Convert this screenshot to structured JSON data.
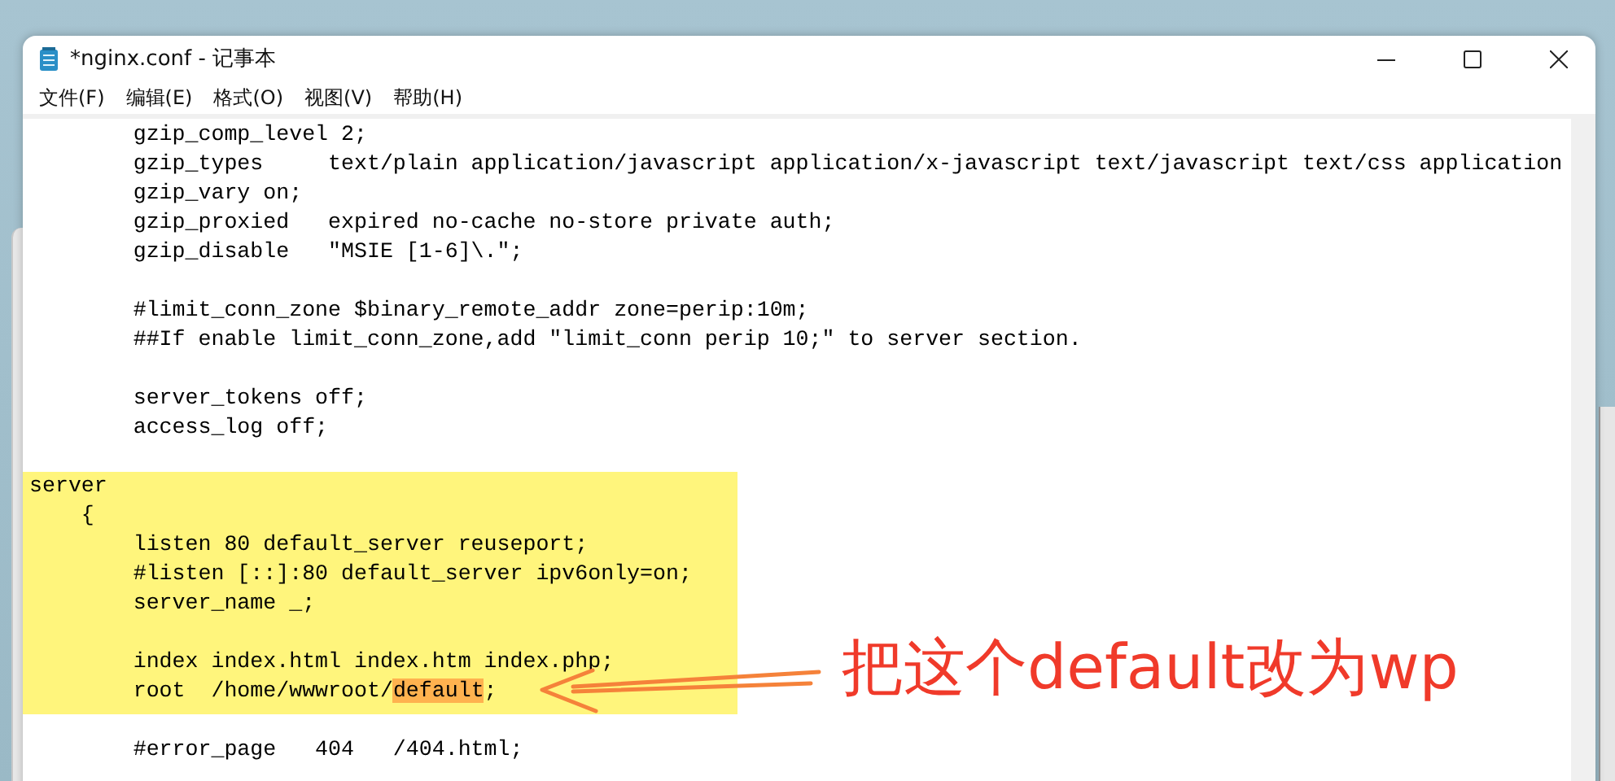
{
  "window": {
    "title": "*nginx.conf - 记事本"
  },
  "menu": [
    "文件(F)",
    "编辑(E)",
    "格式(O)",
    "视图(V)",
    "帮助(H)"
  ],
  "editor": {
    "sections": [
      {
        "highlighted": false,
        "paragraphs": [
          [
            {
              "text": "        gzip_comp_level 2;"
            },
            {
              "text": "        gzip_types     text/plain application/javascript application/x-javascript text/javascript text/css application"
            },
            {
              "text": "        gzip_vary on;"
            },
            {
              "text": "        gzip_proxied   expired no-cache no-store private auth;"
            },
            {
              "text": "        gzip_disable   \"MSIE [1-6]\\.\";"
            }
          ],
          [
            {
              "text": "        #limit_conn_zone $binary_remote_addr zone=perip:10m;"
            },
            {
              "text": "        ##If enable limit_conn_zone,add \"limit_conn perip 10;\" to server section."
            }
          ],
          [
            {
              "text": "        server_tokens off;"
            },
            {
              "text": "        access_log off;"
            }
          ]
        ]
      },
      {
        "highlighted": true,
        "paragraphs": [
          [
            {
              "text": "server"
            },
            {
              "text": "    {"
            },
            {
              "text": "        listen 80 default_server reuseport;"
            },
            {
              "text": "        #listen [::]:80 default_server ipv6only=on;"
            },
            {
              "text": "        server_name _;"
            }
          ],
          [
            {
              "text": "        index index.html index.htm index.php;"
            },
            {
              "segments": [
                {
                  "text": "        root  /home/wwwroot/",
                  "marked": false
                },
                {
                  "text": "default",
                  "marked": true
                },
                {
                  "text": ";",
                  "marked": false
                }
              ]
            }
          ]
        ]
      },
      {
        "highlighted": false,
        "paragraphs": [
          [
            {
              "text": "        #error_page   404   /404.html;"
            }
          ]
        ]
      }
    ]
  },
  "annotation": {
    "text": "把这个default改为wp"
  }
}
